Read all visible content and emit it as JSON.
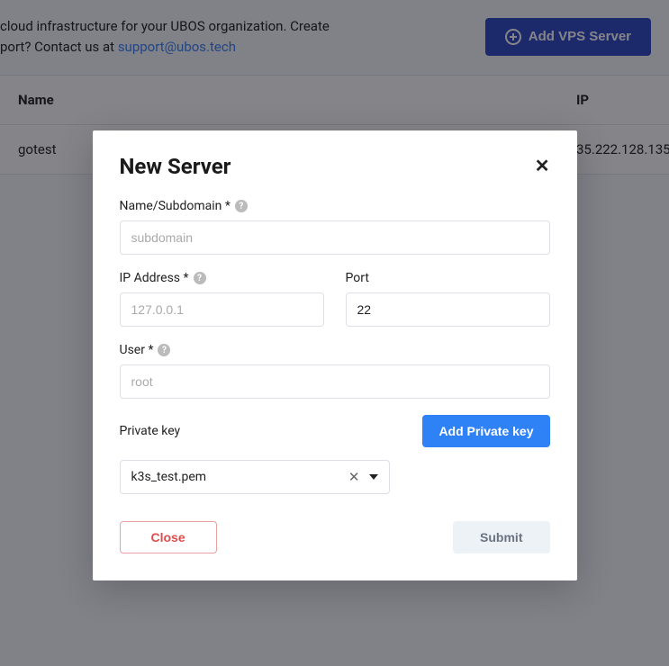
{
  "banner": {
    "text_prefix": "cloud infrastructure for your UBOS organization. Create",
    "text_suffix_prefix": "port? Contact us at ",
    "support_email": "support@ubos.tech",
    "add_vps_label": "Add VPS Server"
  },
  "table": {
    "header_name": "Name",
    "header_ip": "IP",
    "rows": [
      {
        "name": "gotest",
        "ip": "35.222.128.135"
      }
    ]
  },
  "modal": {
    "title": "New Server",
    "fields": {
      "name": {
        "label": "Name/Subdomain *",
        "placeholder": "subdomain",
        "value": ""
      },
      "ip": {
        "label": "IP Address *",
        "placeholder": "127.0.0.1",
        "value": ""
      },
      "port": {
        "label": "Port",
        "placeholder": "",
        "value": "22"
      },
      "user": {
        "label": "User *",
        "placeholder": "root",
        "value": ""
      }
    },
    "private_key": {
      "label": "Private key",
      "add_button": "Add Private key",
      "selected": "k3s_test.pem"
    },
    "buttons": {
      "close": "Close",
      "submit": "Submit"
    },
    "help_char": "?"
  }
}
